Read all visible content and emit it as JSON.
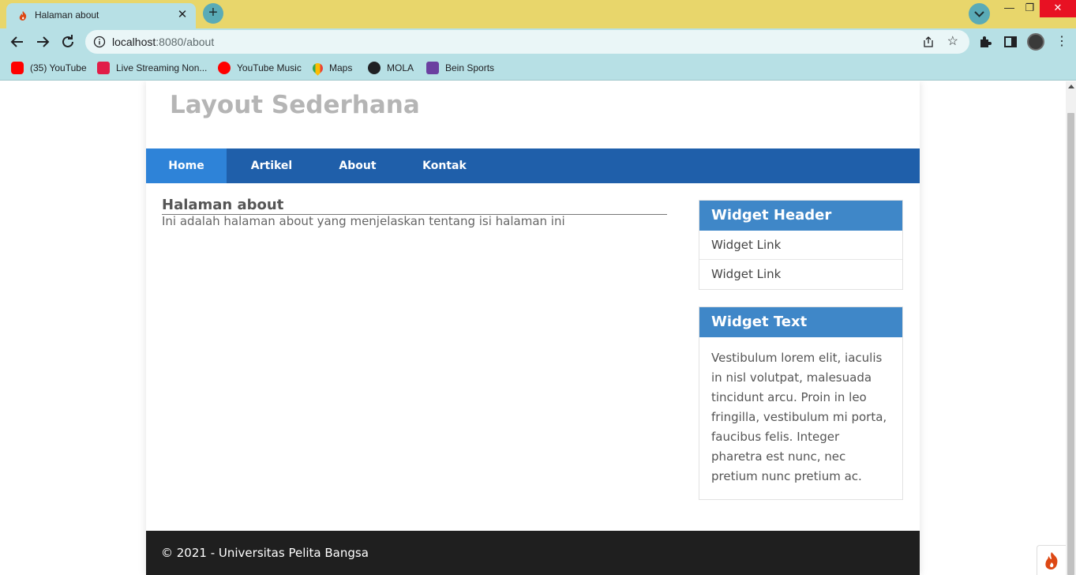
{
  "browser": {
    "tab": {
      "title": "Halaman about",
      "close_glyph": "✕"
    },
    "new_tab_glyph": "+",
    "window": {
      "minimize": "—",
      "restore": "❐",
      "close": "✕"
    },
    "url_host": "localhost",
    "url_port_path": ":8080/about",
    "star_glyph": "☆",
    "menu_glyph": "⋮",
    "bookmarks": [
      {
        "label": "(35) YouTube",
        "icon": "youtube-icon"
      },
      {
        "label": "Live Streaming Non...",
        "icon": "vidio-icon"
      },
      {
        "label": "YouTube Music",
        "icon": "youtube-music-icon"
      },
      {
        "label": "Maps",
        "icon": "maps-icon"
      },
      {
        "label": "MOLA",
        "icon": "globe-icon"
      },
      {
        "label": "Bein Sports",
        "icon": "bein-icon"
      }
    ],
    "colors": {
      "titlebar": "#e8d66b",
      "toolbar": "#b7e0e5"
    }
  },
  "site": {
    "title": "Layout Sederhana",
    "nav": [
      {
        "label": "Home",
        "active": true
      },
      {
        "label": "Artikel",
        "active": false
      },
      {
        "label": "About",
        "active": false
      },
      {
        "label": "Kontak",
        "active": false
      }
    ],
    "content": {
      "title": "Halaman about",
      "text": "Ini adalah halaman about yang menjelaskan tentang isi halaman ini"
    },
    "widgets": {
      "links_header": "Widget Header",
      "links": [
        "Widget Link",
        "Widget Link"
      ],
      "text_header": "Widget Text",
      "text": "Vestibulum lorem elit, iaculis in nisl volutpat, malesuada tincidunt arcu. Proin in leo fringilla, vestibulum mi porta, faucibus felis. Integer pharetra est nunc, nec pretium nunc pretium ac."
    },
    "footer": "© 2021 - Universitas Pelita Bangsa",
    "colors": {
      "nav": "#1f5faa",
      "nav_active": "#2e83d8",
      "widget_header": "#3f87c8",
      "footer": "#1f1f1f"
    }
  }
}
